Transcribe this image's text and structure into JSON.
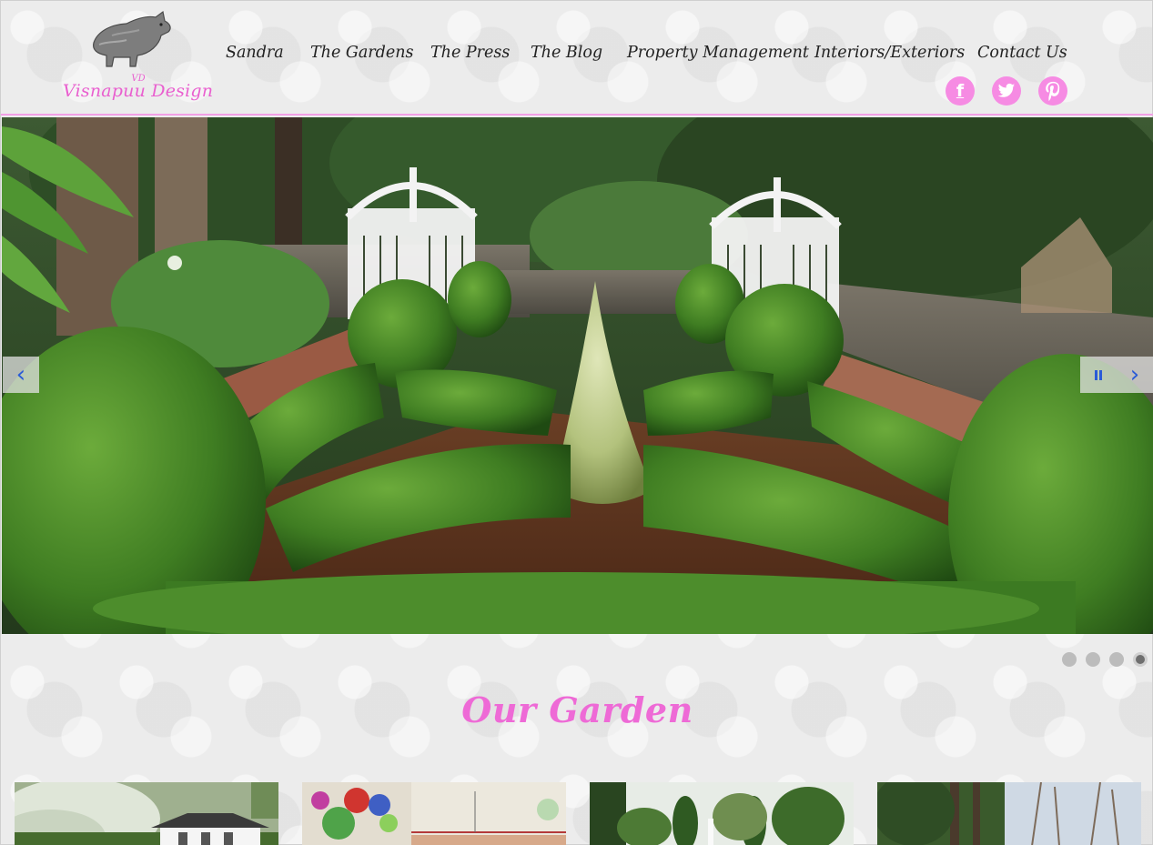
{
  "brand": {
    "logo_text": "Visnapuu Design",
    "logo_mark": "VD",
    "accent_color": "#ee6ad6",
    "header_rule_color": "#f2a0e6"
  },
  "nav": {
    "items": [
      {
        "label": "Sandra"
      },
      {
        "label": "The Gardens"
      },
      {
        "label": "The Press"
      },
      {
        "label": "The Blog"
      },
      {
        "label": "Property Management"
      },
      {
        "label": "Interiors/Exteriors"
      },
      {
        "label": "Contact Us"
      }
    ]
  },
  "social": {
    "facebook": {
      "glyph": "f",
      "icon": "facebook-icon"
    },
    "twitter": {
      "glyph": "t",
      "icon": "twitter-icon"
    },
    "pinterest": {
      "glyph": "P",
      "icon": "pinterest-icon"
    }
  },
  "slider": {
    "prev_glyph": "‹",
    "next_glyph": "›",
    "slide_count": 4,
    "active_slide": 4,
    "image": "boxwood parterre garden with white gates and stone walls"
  },
  "section": {
    "title": "Our Garden"
  },
  "thumbnails": [
    {
      "icon": "house-garden-thumbnail"
    },
    {
      "icon": "garden-plan-thumbnail"
    },
    {
      "icon": "tree-lined-garden-thumbnail"
    },
    {
      "icon": "woodland-thumbnail"
    }
  ]
}
